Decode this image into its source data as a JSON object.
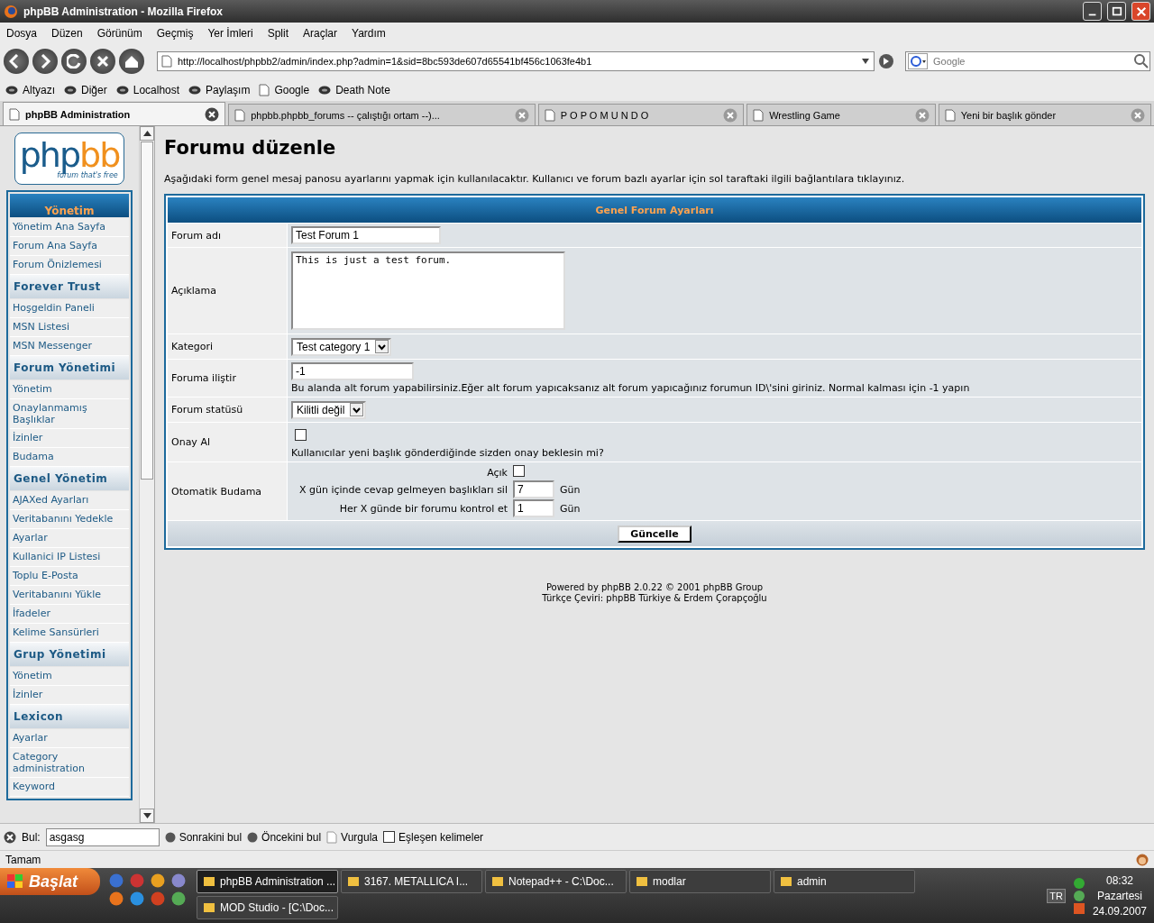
{
  "window": {
    "title": "phpBB Administration - Mozilla Firefox"
  },
  "menu": [
    "Dosya",
    "Düzen",
    "Görünüm",
    "Geçmiş",
    "Yer İmleri",
    "Split",
    "Araçlar",
    "Yardım"
  ],
  "toolbar": {
    "url": "http://localhost/phpbb2/admin/index.php?admin=1&sid=8bc593de607d65541bf456c1063fe4b1",
    "search_placeholder": "Google"
  },
  "bookmarks": [
    {
      "label": "Altyazı",
      "kind": "feed"
    },
    {
      "label": "Diğer",
      "kind": "feed"
    },
    {
      "label": "Localhost",
      "kind": "feed"
    },
    {
      "label": "Paylaşım",
      "kind": "feed"
    },
    {
      "label": "Google",
      "kind": "page"
    },
    {
      "label": "Death Note",
      "kind": "feed"
    }
  ],
  "tabs": [
    {
      "label": "phpBB Administration",
      "selected": true
    },
    {
      "label": "phpbb.phpbb_forums -- çalıştığı ortam --)...",
      "selected": false
    },
    {
      "label": "P O P O M U N D O",
      "selected": false
    },
    {
      "label": "Wrestling Game",
      "selected": false
    },
    {
      "label": "Yeni bir başlık gönder",
      "selected": false
    }
  ],
  "sidebar": {
    "logo": {
      "part1": "php",
      "part2": "bb",
      "tagline": "forum that's free"
    },
    "sections": [
      {
        "title": "Yönetim",
        "kind": "main",
        "items": [
          "Yönetim Ana Sayfa",
          "Forum Ana Sayfa",
          "Forum Önizlemesi"
        ]
      },
      {
        "title": "Forever Trust",
        "kind": "group",
        "items": [
          "Hoşgeldin Paneli",
          "MSN Listesi",
          "MSN Messenger"
        ]
      },
      {
        "title": "Forum Yönetimi",
        "kind": "group",
        "items": [
          "Yönetim",
          "Onaylanmamış Başlıklar",
          "İzinler",
          "Budama"
        ]
      },
      {
        "title": "Genel Yönetim",
        "kind": "group",
        "items": [
          "AJAXed Ayarları",
          "Veritabanını Yedekle",
          "Ayarlar",
          "Kullanici IP Listesi",
          "Toplu E-Posta",
          "Veritabanını Yükle",
          "İfadeler",
          "Kelime Sansürleri"
        ]
      },
      {
        "title": "Grup Yönetimi",
        "kind": "group",
        "items": [
          "Yönetim",
          "İzinler"
        ]
      },
      {
        "title": "Lexicon",
        "kind": "group",
        "items": [
          "Ayarlar",
          "Category administration",
          "Keyword"
        ]
      }
    ]
  },
  "page": {
    "heading": "Forumu düzenle",
    "intro": "Aşağıdaki form genel mesaj panosu ayarlarını yapmak için kullanılacaktır. Kullanıcı ve forum bazlı ayarlar için sol taraftaki ilgili bağlantılara tıklayınız.",
    "panel_title": "Genel Forum Ayarları",
    "rows": [
      {
        "label": "Forum adı",
        "kind": "text",
        "value": "Test Forum 1"
      },
      {
        "label": "Açıklama",
        "kind": "textarea",
        "value": "This is just a test forum."
      },
      {
        "label": "Kategori",
        "kind": "select",
        "value": "Test category 1"
      },
      {
        "label": "Foruma iliştir",
        "kind": "text_hint",
        "value": "-1",
        "hint": "Bu alanda alt forum yapabilirsiniz.Eğer alt forum yapıcaksanız alt forum yapıcağınız forumun ID\\'sini giriniz. Normal kalması için -1 yapın"
      },
      {
        "label": "Forum statüsü",
        "kind": "select",
        "value": "Kilitli değil"
      },
      {
        "label": "Onay Al",
        "kind": "checkbox_hint",
        "checked": false,
        "hint": "Kullanıcılar yeni başlık gönderdiğinde sizden onay beklesin mi?"
      },
      {
        "label": "Otomatik Budama",
        "kind": "prune",
        "enable": {
          "label": "Açık",
          "checked": false
        },
        "fields": [
          {
            "label": "X gün içinde cevap gelmeyen başlıkları sil",
            "value": "7",
            "unit": "Gün"
          },
          {
            "label": "Her X günde bir forumu kontrol et",
            "value": "1",
            "unit": "Gün"
          }
        ]
      }
    ],
    "button": "Güncelle",
    "footer": [
      "Powered by phpBB 2.0.22 © 2001 phpBB Group",
      "Türkçe Çeviri: phpBB Türkiye & Erdem Çorapçoğlu"
    ]
  },
  "findbar": {
    "label": "Bul:",
    "value": "asgasg",
    "next": "Sonrakini bul",
    "prev": "Öncekini bul",
    "highlight": "Vurgula",
    "match_case": {
      "label": "Eşleşen kelimeler",
      "checked": false
    }
  },
  "status_bar": "Tamam",
  "taskbar": {
    "start": "Başlat",
    "tasks": [
      {
        "label": "phpBB Administration ...",
        "selected": true
      },
      {
        "label": "3167. METALLICA   I...",
        "selected": false
      },
      {
        "label": "Notepad++ - C:\\Doc...",
        "selected": false
      },
      {
        "label": "modlar",
        "selected": false
      },
      {
        "label": "admin",
        "selected": false
      },
      {
        "label": "MOD Studio - [C:\\Doc...",
        "selected": false
      }
    ],
    "language": "TR",
    "time": "08:32",
    "day": "Pazartesi",
    "date": "24.09.2007"
  }
}
